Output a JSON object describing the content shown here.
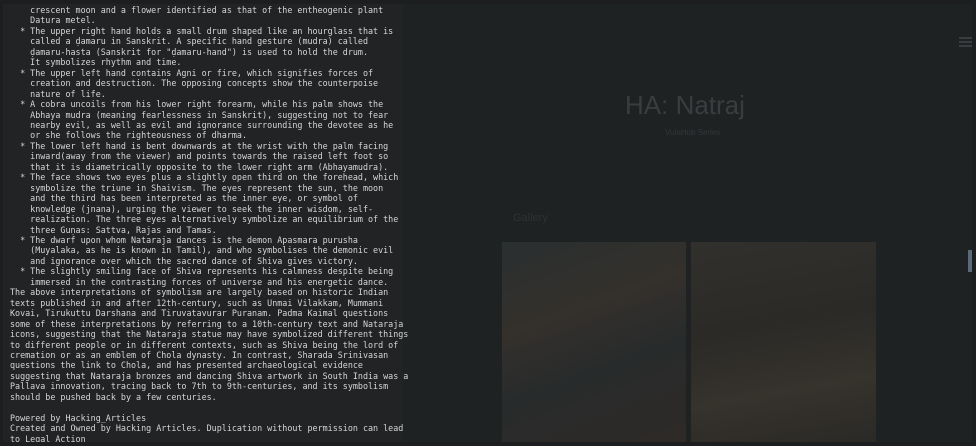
{
  "page": {
    "title": "HA: Natraj",
    "subtitle": "VulnHub Series",
    "section_label": "Gallery"
  },
  "body_lines": [
    "    crescent moon and a flower identified as that of the entheogenic plant",
    "    Datura metel.",
    "  * The upper right hand holds a small drum shaped like an hourglass that is",
    "    called a ḍamaru in Sanskrit. A specific hand gesture (mudra) called",
    "    ḍamaru-hasta (Sanskrit for \"ḍamaru-hand\") is used to hold the drum.",
    "    It symbolizes rhythm and time.",
    "  * The upper left hand contains Agni or fire, which signifies forces of",
    "    creation and destruction. The opposing concepts show the counterpoise",
    "    nature of life.",
    "  * A cobra uncoils from his lower right forearm, while his palm shows the",
    "    Abhaya mudra (meaning fearlessness in Sanskrit), suggesting not to fear",
    "    nearby evil, as well as evil and ignorance surrounding the devotee as he",
    "    or she follows the righteousness of dharma.",
    "  * The lower left hand is bent downwards at the wrist with the palm facing",
    "    inward(away from the viewer) and points towards the raised left foot so",
    "    that it is diametrically opposite to the lower right arm (Abhayamudra).",
    "  * The face shows two eyes plus a slightly open third on the forehead, which",
    "    symbolize the triune in Shaivism. The eyes represent the sun, the moon",
    "    and the third has been interpreted as the inner eye, or symbol of",
    "    knowledge (jnana), urging the viewer to seek the inner wisdom, self-",
    "    realization. The three eyes alternatively symbolize an equilibrium of the",
    "    three Guṇas: Sattva, Rajas and Tamas.",
    "  * The dwarf upon whom Nataraja dances is the demon Apasmara purusha",
    "    (Muyalaka, as he is known in Tamil), and who symbolises the demonic evil",
    "    and ignorance over which the sacred dance of Shiva gives victory.",
    "  * The slightly smiling face of Shiva represents his calmness despite being",
    "    immersed in the contrasting forces of universe and his energetic dance.",
    "The above interpretations of symbolism are largely based on historic Indian",
    "texts published in and after 12th-century, such as Unmai Vilakkam, Mummani",
    "Kovai, Tirukuttu Darshana and Tiruvatavurar Puranam. Padma Kaimal questions",
    "some of these interpretations by referring to a 10th-century text and Nataraja",
    "icons, suggesting that the Nataraja statue may have symbolized different things",
    "to different people or in different contexts, such as Shiva being the lord of",
    "cremation or as an emblem of Chola dynasty. In contrast, Sharada Srinivasan",
    "questions the link to Chola, and has presented archaeological evidence",
    "suggesting that Nataraja bronzes and dancing Shiva artwork in South India was a",
    "Pallava innovation, tracing back to 7th to 9th-centuries, and its symbolism",
    "should be pushed back by a few centuries.",
    "",
    "Powered by Hacking_Articles",
    "Created and Owned by Hacking Articles. Duplication without permission can lead",
    "to Legal Action"
  ]
}
